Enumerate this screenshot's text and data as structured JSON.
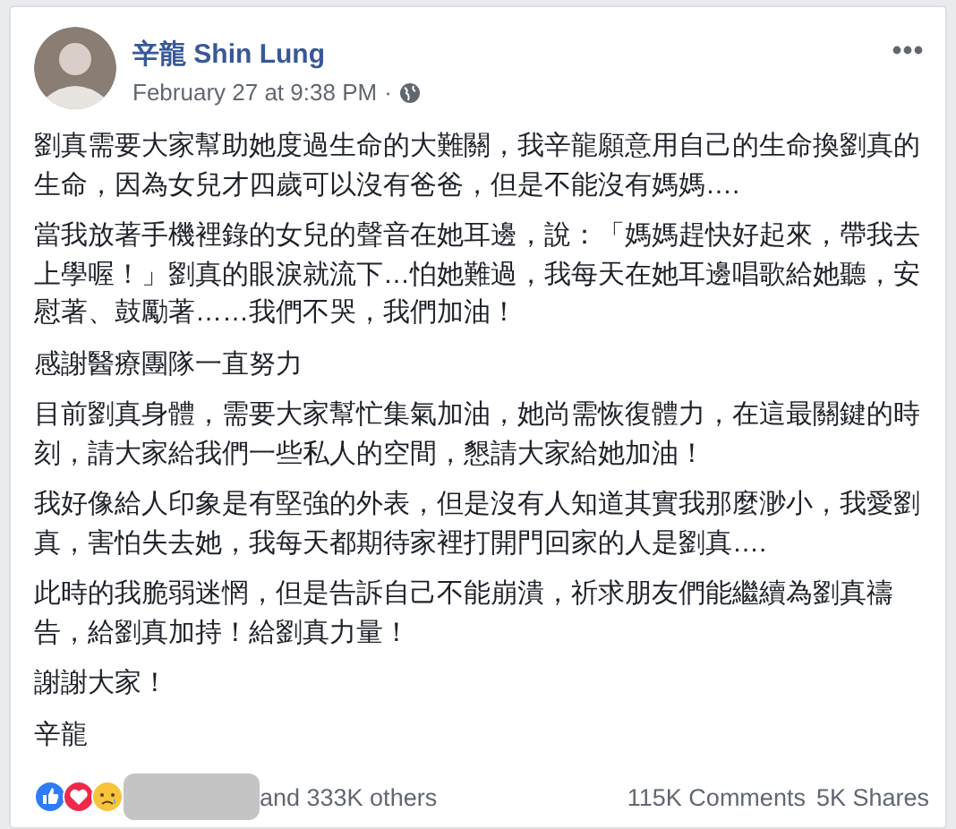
{
  "post": {
    "author": "辛龍 Shin Lung",
    "timestamp": "February 27 at 9:38 PM",
    "separator": "·",
    "paragraphs": [
      "劉真需要大家幫助她度過生命的大難關，我辛龍願意用自己的生命換劉真的生命，因為女兒才四歲可以沒有爸爸，但是不能沒有媽媽….",
      "當我放著手機裡錄的女兒的聲音在她耳邊，說：「媽媽趕快好起來，帶我去上學喔！」劉真的眼淚就流下…怕她難過，我每天在她耳邊唱歌給她聽，安慰著、鼓勵著……我們不哭，我們加油！",
      "感謝醫療團隊一直努力",
      "目前劉真身體，需要大家幫忙集氣加油，她尚需恢復體力，在這最關鍵的時刻，請大家給我們一些私人的空間，懇請大家給她加油！",
      "我好像給人印象是有堅強的外表，但是沒有人知道其實我那麼渺小，我愛劉真，害怕失去她，我每天都期待家裡打開門回家的人是劉真….",
      "此時的我脆弱迷惘，但是告訴自己不能崩潰，祈求朋友們能繼續為劉真禱告，給劉真加持！給劉真力量！",
      "謝謝大家！",
      "辛龍"
    ]
  },
  "reactions": [
    {
      "kind": "like"
    },
    {
      "kind": "love"
    },
    {
      "kind": "sad"
    }
  ],
  "reaction_summary": "and 333K others",
  "comments": "115K Comments",
  "shares": "5K Shares"
}
